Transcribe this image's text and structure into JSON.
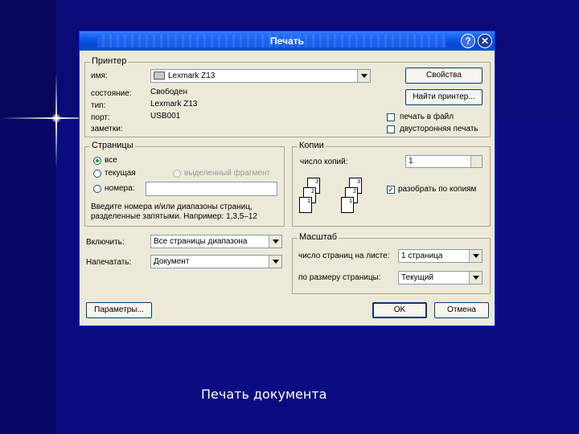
{
  "caption": "Печать документа",
  "dialog": {
    "title": "Печать",
    "help_icon": "?",
    "close_icon": "✕",
    "printer": {
      "group_label": "Принтер",
      "name_label": "имя:",
      "name_value": "Lexmark Z13",
      "status_label": "состояние:",
      "status_value": "Свободен",
      "type_label": "тип:",
      "type_value": "Lexmark Z13",
      "port_label": "порт:",
      "port_value": "USB001",
      "notes_label": "заметки:",
      "properties_button": "Свойства",
      "find_printer_button": "Найти принтер...",
      "print_to_file_label": "печать в файл",
      "duplex_label": "двусторонняя печать"
    },
    "pages": {
      "group_label": "Страницы",
      "all_label": "все",
      "current_label": "текущая",
      "selection_label": "выделенный фрагмент",
      "numbers_label": "номера:",
      "hint_line1": "Введите номера и/или диапазоны страниц,",
      "hint_line2": "разделенные запятыми. Например: 1,3,5–12"
    },
    "copies": {
      "group_label": "Копии",
      "count_label": "число копий:",
      "count_value": "1",
      "collate_label": "разобрать по копиям",
      "collate_icon_pages": [
        "3",
        "2",
        "1",
        "3",
        "2",
        "1"
      ]
    },
    "include_label": "Включить:",
    "include_value": "Все страницы диапазона",
    "print_what_label": "Напечатать:",
    "print_what_value": "Документ",
    "zoom": {
      "group_label": "Масштаб",
      "pages_per_sheet_label": "число страниц на листе:",
      "pages_per_sheet_value": "1 страница",
      "scale_to_paper_label": "по размеру страницы:",
      "scale_to_paper_value": "Текущий"
    },
    "options_button": "Параметры...",
    "ok_button": "OK",
    "cancel_button": "Отмена"
  }
}
